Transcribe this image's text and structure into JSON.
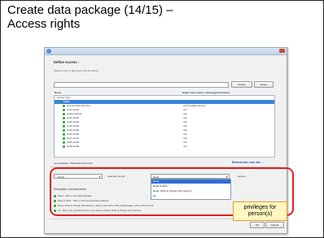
{
  "slide": {
    "title_line1": "Create data package (14/15) –",
    "title_line2": "Access rights"
  },
  "dialog": {
    "heading": "Define Access :",
    "instruction": "Select a user or group from the list below :",
    "search_button": "Search",
    "reset_button": "Reset",
    "columns": {
      "name": "Name",
      "email": "Email / Description / Distinguished Name"
    },
    "tree_rows": [
      {
        "name": "Access Type",
        "email": ""
      },
      {
        "name": "EMBL",
        "email": ""
      },
      {
        "name": "Emma (Class Service)",
        "email": "embl.test@gmail.com"
      },
      {
        "name": "test1 (test1)",
        "email": "null"
      },
      {
        "name": "test10 (test10)",
        "email": "null"
      },
      {
        "name": "test2 (test2)",
        "email": "null"
      },
      {
        "name": "test3 (test3)",
        "email": "null"
      },
      {
        "name": "test4 (test4)",
        "email": "null"
      },
      {
        "name": "test5 (test5)",
        "email": "null"
      },
      {
        "name": "test6 (test6)",
        "email": "null"
      },
      {
        "name": "test7 (test7)",
        "email": "null"
      },
      {
        "name": "test8 (test8)",
        "email": "null"
      },
      {
        "name": "test9 (test9)",
        "email": "null"
      }
    ],
    "last_modified": "Last Modified : 09/03/2012 09:10:20",
    "refresh_link": "Refresh this user list ...",
    "user_select": "- Admin -",
    "selected_user_label": "selected user(s)",
    "privilege_select": "Read",
    "access_label": "access.",
    "privilege_options": [
      "Read",
      "Read & Write",
      "Read, Write & Change Permissions",
      "All"
    ],
    "desc_title": "Description of access levels :",
    "desc_items": [
      "Read - Able to view data package.",
      "Read & Write - Able to view and edit data package.",
      "Read, Write & Change Permissions - Able to view and modify datapackage, and modify access",
      "All - Able to do everything (this is the same as Read, Write & Change Permissions)"
    ],
    "ok_button": "OK",
    "cancel_button": "Cancel"
  },
  "callout": {
    "line1": "privileges for",
    "line2": "person(s)"
  }
}
